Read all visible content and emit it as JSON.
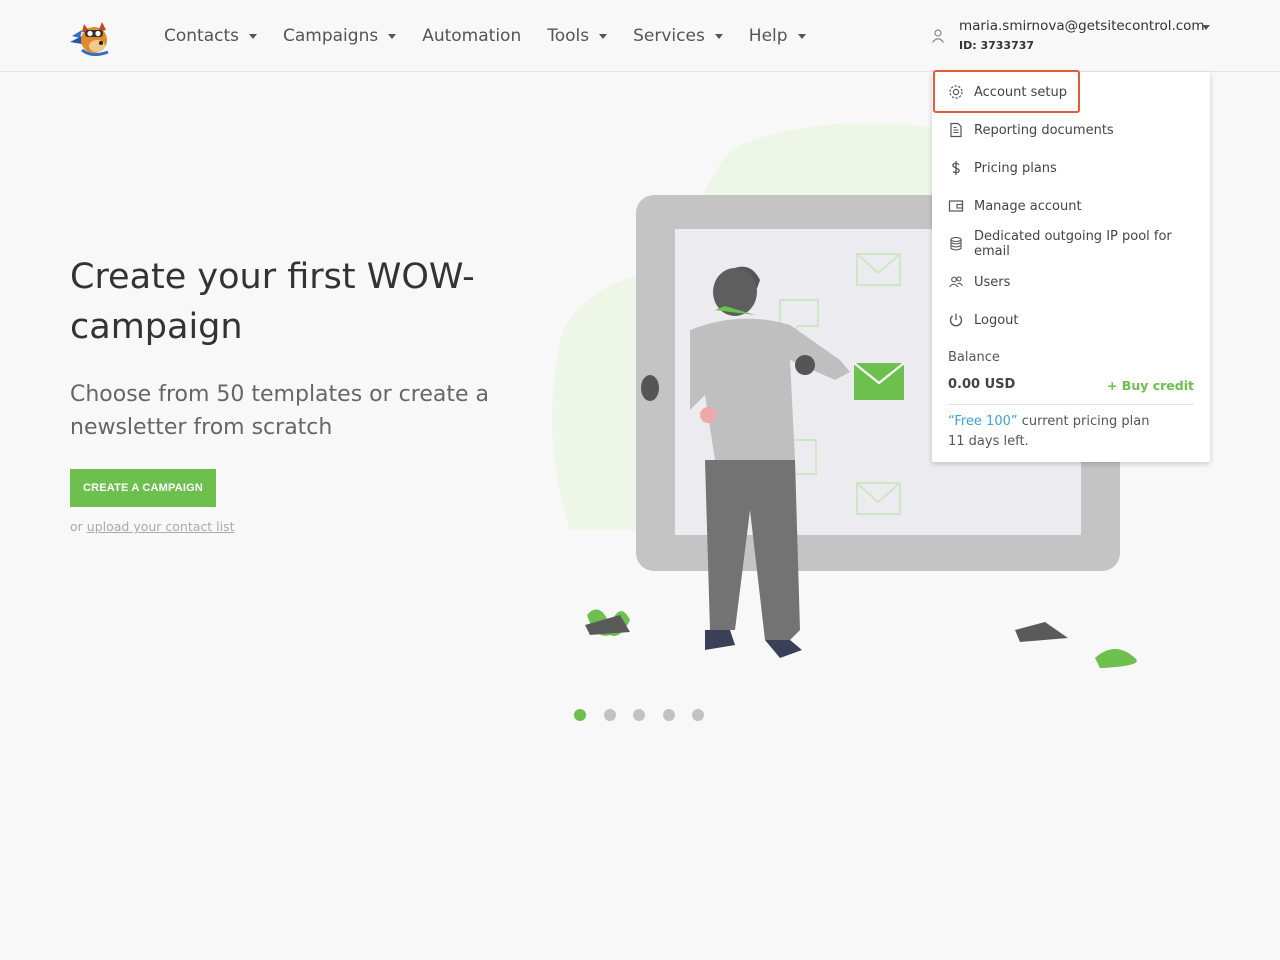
{
  "nav": {
    "items": [
      {
        "label": "Contacts",
        "caret": true
      },
      {
        "label": "Campaigns",
        "caret": true
      },
      {
        "label": "Automation",
        "caret": false
      },
      {
        "label": "Tools",
        "caret": true
      },
      {
        "label": "Services",
        "caret": true
      },
      {
        "label": "Help",
        "caret": true
      }
    ]
  },
  "user": {
    "email": "maria.smirnova@getsitecontrol.com",
    "id": "ID: 3733737"
  },
  "hero": {
    "title": "Create your first WOW-campaign",
    "subtitle": "Choose from 50 templates or create a newsletter from scratch",
    "cta": "CREATE A CAMPAIGN",
    "alt_prefix": "or",
    "alt_link": "upload your contact list"
  },
  "carousel": {
    "count": 5,
    "active": 0
  },
  "dropdown": {
    "items": [
      {
        "label": "Account setup",
        "icon": "gear-icon"
      },
      {
        "label": "Reporting documents",
        "icon": "document-icon"
      },
      {
        "label": "Pricing plans",
        "icon": "dollar-icon"
      },
      {
        "label": "Manage account",
        "icon": "wallet-icon"
      },
      {
        "label": "Dedicated outgoing IP pool for email",
        "icon": "database-icon"
      },
      {
        "label": "Users",
        "icon": "users-icon"
      },
      {
        "label": "Logout",
        "icon": "power-icon"
      }
    ],
    "balance_label": "Balance",
    "balance_value": "0.00 USD",
    "buy_credit": "+ Buy credit",
    "plan_name": "“Free 100”",
    "plan_suffix": "current pricing plan",
    "days_left": "11 days left."
  },
  "colors": {
    "accent": "#6dc04d",
    "link": "#3fa2d9",
    "highlight": "#e25a3c"
  }
}
